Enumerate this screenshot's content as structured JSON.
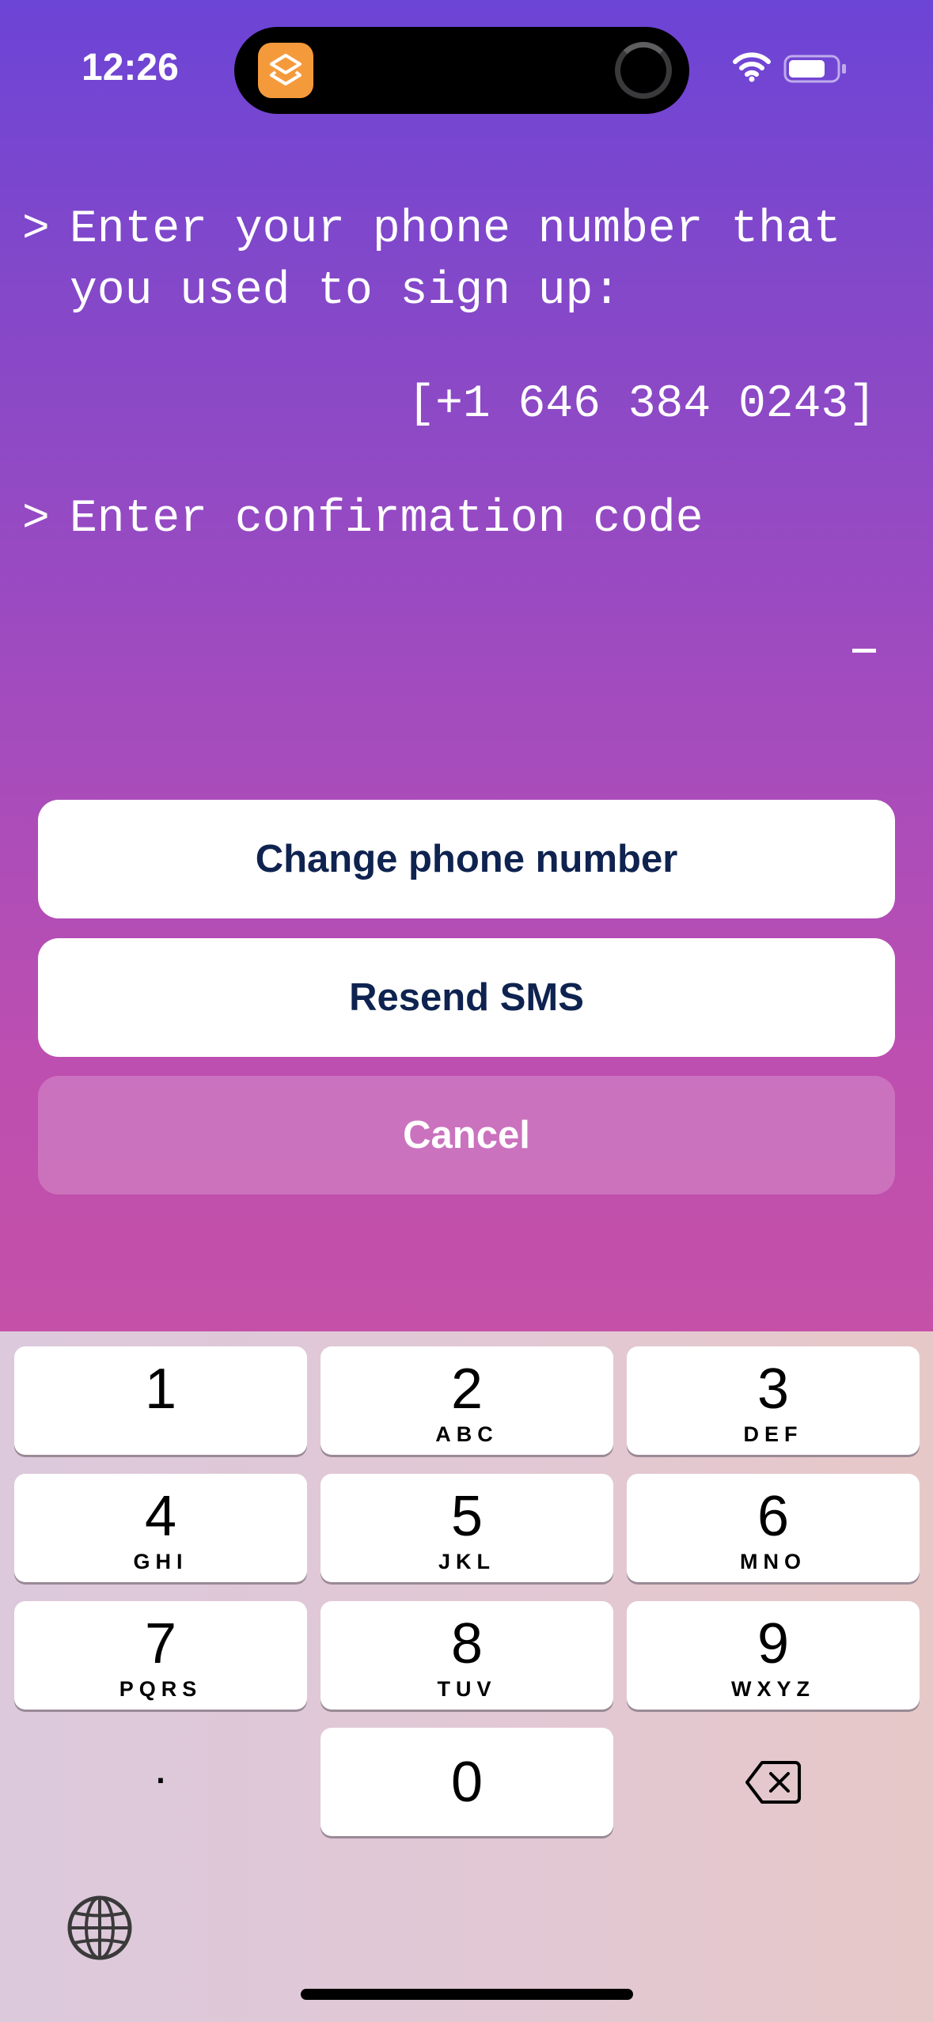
{
  "status_bar": {
    "time": "12:26",
    "icons": [
      "shortcuts-app-icon",
      "activity-spinner-icon",
      "wifi-icon",
      "battery-icon"
    ]
  },
  "terminal": {
    "caret": ">",
    "phone_prompt": "Enter your phone number that\nyou used to sign up:",
    "phone_value": "[+1 646 384 0243]",
    "code_prompt": "Enter confirmation code"
  },
  "buttons": {
    "change_phone": "Change phone number",
    "resend_sms": "Resend SMS",
    "cancel": "Cancel"
  },
  "keypad": {
    "keys": [
      {
        "digit": "1",
        "letters": ""
      },
      {
        "digit": "2",
        "letters": "ABC"
      },
      {
        "digit": "3",
        "letters": "DEF"
      },
      {
        "digit": "4",
        "letters": "GHI"
      },
      {
        "digit": "5",
        "letters": "JKL"
      },
      {
        "digit": "6",
        "letters": "MNO"
      },
      {
        "digit": "7",
        "letters": "PQRS"
      },
      {
        "digit": "8",
        "letters": "TUV"
      },
      {
        "digit": "9",
        "letters": "WXYZ"
      },
      {
        "digit": "0",
        "letters": ""
      }
    ],
    "dot": ".",
    "icons": [
      "delete-icon",
      "globe-icon"
    ]
  },
  "colors": {
    "gradient_top": "#6c44d6",
    "gradient_bottom": "#c450a8",
    "button_text": "#0f2350",
    "island_icon": "#f59a3b"
  }
}
